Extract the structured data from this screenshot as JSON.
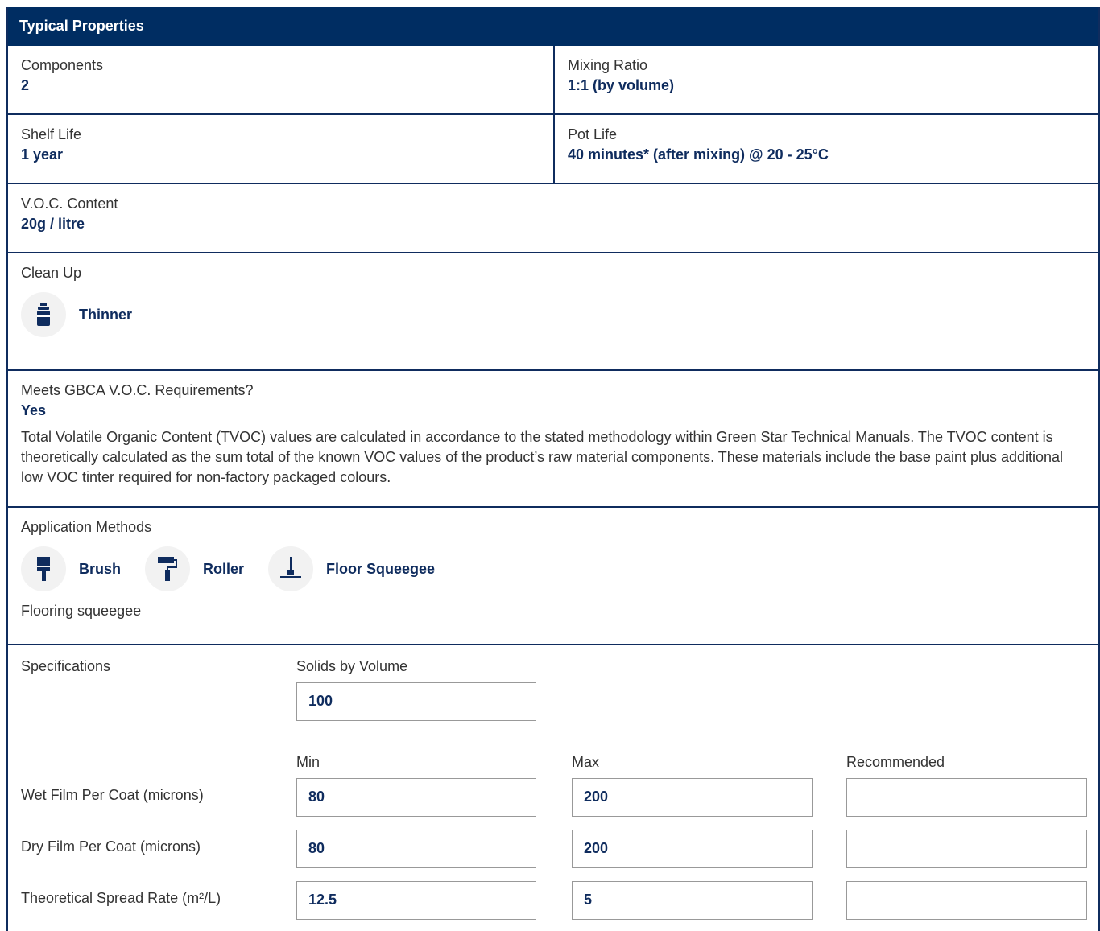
{
  "header": {
    "title": "Typical Properties"
  },
  "components": {
    "label": "Components",
    "value": "2"
  },
  "mixing_ratio": {
    "label": "Mixing Ratio",
    "value": "1:1 (by volume)"
  },
  "shelf_life": {
    "label": "Shelf Life",
    "value": "1 year"
  },
  "pot_life": {
    "label": "Pot Life",
    "value": "40 minutes* (after mixing) @ 20 - 25°C"
  },
  "voc": {
    "label": "V.O.C. Content",
    "value": "20g / litre"
  },
  "clean_up": {
    "label": "Clean Up",
    "item": "Thinner",
    "icon": "thinner-can-icon"
  },
  "gbca": {
    "label": "Meets GBCA V.O.C. Requirements?",
    "value": "Yes",
    "description": "Total Volatile Organic Content (TVOC) values are calculated in accordance to the stated methodology within Green Star Technical Manuals. The TVOC content is theoretically calculated as the sum total of the known VOC values of the product’s raw material components. These materials include the base paint plus additional low VOC tinter required for non-factory packaged colours."
  },
  "application": {
    "label": "Application Methods",
    "methods": [
      {
        "label": "Brush",
        "icon": "brush-icon"
      },
      {
        "label": "Roller",
        "icon": "roller-icon"
      },
      {
        "label": "Floor Squeegee",
        "icon": "squeegee-icon"
      }
    ],
    "note": "Flooring squeegee"
  },
  "specifications": {
    "label": "Specifications",
    "solids_label": "Solids by Volume",
    "solids_value": "100",
    "col_min": "Min",
    "col_max": "Max",
    "col_recommended": "Recommended",
    "rows": [
      {
        "label": "Wet Film Per Coat (microns)",
        "min": "80",
        "max": "200",
        "recommended": ""
      },
      {
        "label": "Dry Film Per Coat (microns)",
        "min": "80",
        "max": "200",
        "recommended": ""
      },
      {
        "label": "Theoretical Spread Rate (m²/L)",
        "min": "12.5",
        "max": "5",
        "recommended": ""
      }
    ]
  },
  "colors": {
    "navy": "#002d62",
    "border": "#0f2c5e",
    "icon_bg": "#f2f2f2"
  }
}
